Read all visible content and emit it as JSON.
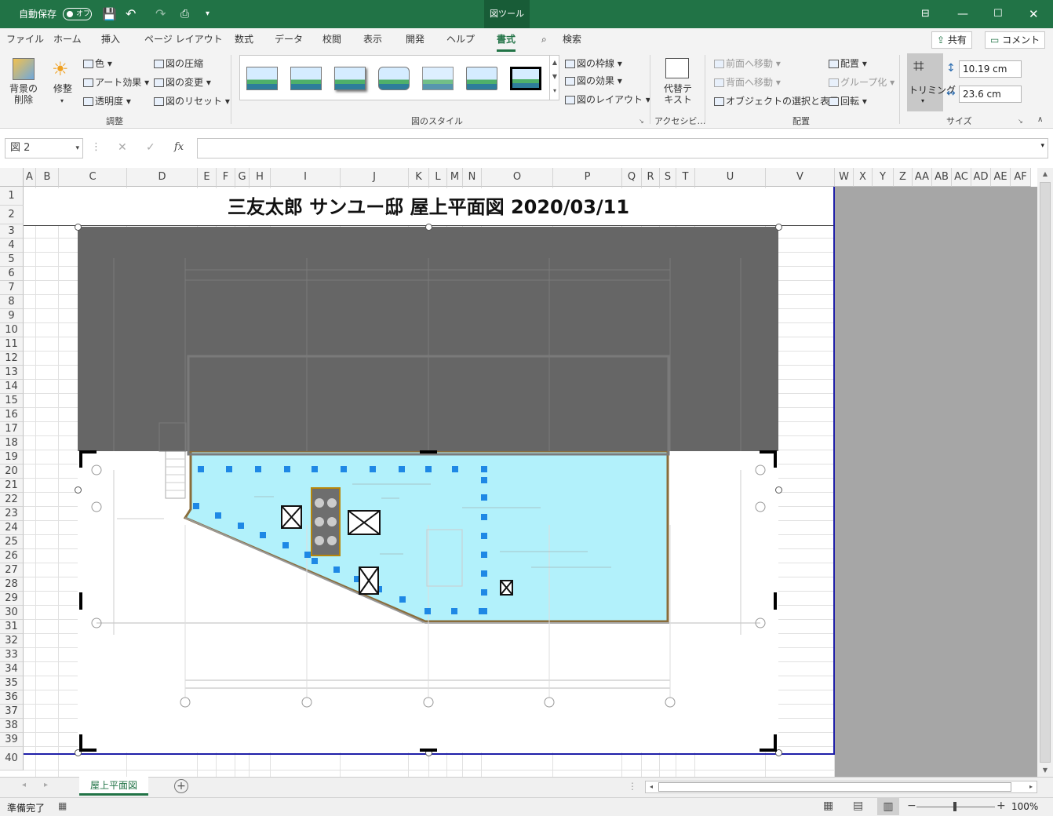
{
  "titlebar": {
    "autosave": "自動保存",
    "autosave_state": "オフ",
    "context_tab": "図ツール"
  },
  "menu": {
    "tabs": [
      "ファイル",
      "ホーム",
      "挿入",
      "ページ レイアウト",
      "数式",
      "データ",
      "校閲",
      "表示",
      "開発",
      "ヘルプ",
      "書式"
    ],
    "search": "検索",
    "share": "共有",
    "comment": "コメント"
  },
  "ribbon": {
    "remove_bg": "背景の\n削除",
    "corrections": "修整",
    "color": "色",
    "artistic": "アート効果",
    "transparency": "透明度",
    "compress": "図の圧縮",
    "change": "図の変更",
    "reset": "図のリセット",
    "group_adjust": "調整",
    "group_styles": "図のスタイル",
    "border": "図の枠線",
    "effects": "図の効果",
    "layout": "図のレイアウト",
    "alt_text": "代替テ\nキスト",
    "group_access": "アクセシビ…",
    "bring_forward": "前面へ移動",
    "send_backward": "背面へ移動",
    "selection_pane": "オブジェクトの選択と表示",
    "align": "配置",
    "group": "グループ化",
    "rotate": "回転",
    "group_arrange": "配置",
    "crop": "トリミング",
    "height": "10.19 cm",
    "width": "23.6 cm",
    "group_size": "サイズ"
  },
  "formula": {
    "name_box": "図 2",
    "fx": "fx"
  },
  "sheet": {
    "columns": [
      "A",
      "B",
      "C",
      "D",
      "E",
      "F",
      "G",
      "H",
      "I",
      "J",
      "K",
      "L",
      "M",
      "N",
      "O",
      "P",
      "Q",
      "R",
      "S",
      "T",
      "U",
      "V",
      "W",
      "X",
      "Y",
      "Z",
      "AA",
      "AB",
      "AC",
      "AD",
      "AE",
      "AF"
    ],
    "rows": [
      "1",
      "2",
      "3",
      "4",
      "5",
      "6",
      "7",
      "8",
      "9",
      "10",
      "11",
      "12",
      "13",
      "14",
      "15",
      "16",
      "17",
      "18",
      "19",
      "20",
      "21",
      "22",
      "23",
      "24",
      "25",
      "26",
      "27",
      "28",
      "29",
      "30",
      "31",
      "32",
      "33",
      "34",
      "35",
      "36",
      "37",
      "38",
      "39",
      "40"
    ],
    "title": "三友太郎 サンユー邸 屋上平面図  2020/03/11"
  },
  "tabs": {
    "sheet_tab": "屋上平面図"
  },
  "status": {
    "ready": "準備完了",
    "zoom": "100%"
  }
}
